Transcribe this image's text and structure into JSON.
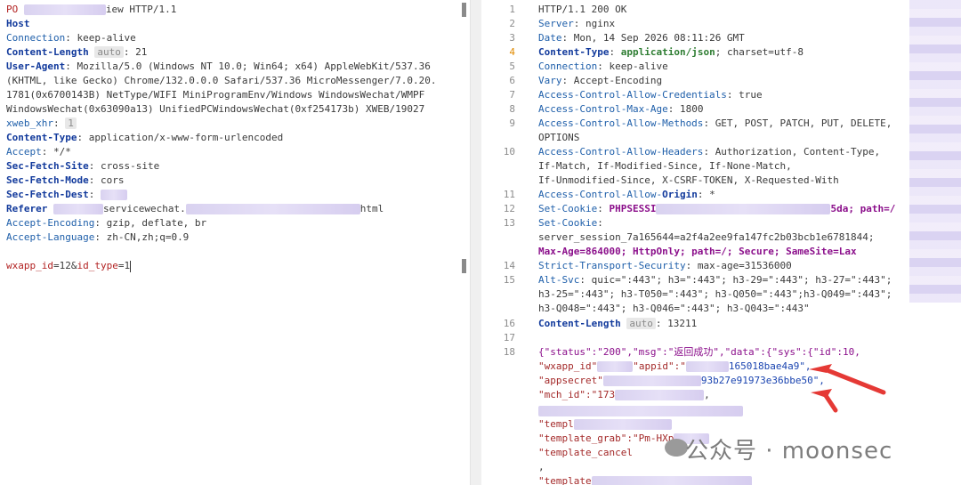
{
  "request": {
    "line1_prefix": "PO",
    "line1_suffix": "iew HTTP/1.1",
    "host_key": "Host",
    "connection_key": "Connection",
    "connection_val": "keep-alive",
    "content_length_key": "Content-Length",
    "auto_badge": "auto",
    "content_length_val": "21",
    "ua_key": "User-Agent",
    "ua_line1": "Mozilla/5.0 (Windows NT 10.0; Win64; x64) AppleWebKit/537.36",
    "ua_line2": "(KHTML, like Gecko) Chrome/132.0.0.0 Safari/537.36 MicroMessenger/7.0.20.",
    "ua_line3": "1781(0x6700143B) NetType/WIFI MiniProgramEnv/Windows WindowsWechat/WMPF",
    "ua_line4": "WindowsWechat(0x63090a13) UnifiedPCWindowsWechat(0xf254173b) XWEB/19027",
    "xweb_key": "xweb_xhr",
    "xweb_val": "1",
    "ctype_key": "Content-Type",
    "ctype_val": "application/x-www-form-urlencoded",
    "accept_key": "Accept",
    "accept_val": "*/*",
    "sfs_key": "Sec-Fetch-Site",
    "sfs_val": "cross-site",
    "sfm_key": "Sec-Fetch-Mode",
    "sfm_val": "cors",
    "sfd_key": "Sec-Fetch-Dest",
    "referer_key": "Referer",
    "referer_mid": "servicewechat.",
    "referer_end": "html",
    "ae_key": "Accept-Encoding",
    "ae_val": "gzip, deflate, br",
    "al_key": "Accept-Language",
    "al_val": "zh-CN,zh;q=0.9",
    "body_a": "wxapp_id",
    "body_b": "=12&",
    "body_c": "id_type",
    "body_d": "=1"
  },
  "response": {
    "line_numbers": [
      "1",
      "2",
      "3",
      "4",
      "5",
      "6",
      "7",
      "8",
      "9",
      "10",
      "11",
      "12",
      "13",
      "14",
      "15",
      "16",
      "17",
      "18"
    ],
    "status_line": "HTTP/1.1 200 OK",
    "server_key": "Server",
    "server_val": "nginx",
    "date_key": "Date",
    "date_val": "Mon, 14 Sep 2026 08:11:26 GMT",
    "ct_key": "Content-Type",
    "ct_val_a": "application/json",
    "ct_val_b": "; charset=utf-8",
    "conn_key": "Connection",
    "conn_val": "keep-alive",
    "vary_key": "Vary",
    "vary_val": "Accept-Encoding",
    "acac_key": "Access-Control-Allow-Credentials",
    "acac_val": "true",
    "acma_key": "Access-Control-Max-Age",
    "acma_val": "1800",
    "acam_key": "Access-Control-Allow-Methods",
    "acam_val1": "GET, POST, PATCH, PUT, DELETE,",
    "acam_val2": "OPTIONS",
    "acah_key": "Access-Control-Allow-Headers",
    "acah_val1": "Authorization, Content-Type,",
    "acah_val2": "If-Match, If-Modified-Since, If-None-Match,",
    "acah_val3": "If-Unmodified-Since, X-CSRF-TOKEN, X-Requested-With",
    "acao_key_a": "Access-Control-Allow-",
    "acao_key_b": "Origin",
    "acao_val": "*",
    "sc1_key": "Set-Cookie",
    "sc1_val_a": "PHPSESSI",
    "sc1_val_b": "5da",
    "sc1_val_c": "; path=/",
    "sc2_key": "Set-Cookie",
    "sc2_val": "server_session_7a165644=a2f4a2ee9fa147fc2b03bcb1e6781844;",
    "sc2_val2": "Max-Age=864000; HttpOnly; path=/; Secure; SameSite=Lax",
    "sts_key": "Strict-Transport-Security",
    "sts_val": "max-age=31536000",
    "alt_key": "Alt-Svc",
    "alt_val1": "quic=\":443\"; h3=\":443\"; h3-29=\":443\"; h3-27=\":443\";",
    "alt_val2": "h3-25=\":443\"; h3-T050=\":443\"; h3-Q050=\":443\";h3-Q049=\":443\";",
    "alt_val3": "h3-Q048=\":443\"; h3-Q046=\":443\"; h3-Q043=\":443\"",
    "cl_key": "Content-Length",
    "cl_badge": "auto",
    "cl_val": "13211",
    "json1": "{\"status\":\"200\",\"msg\":\"返回成功\",\"data\":{\"sys\":{\"id\":10,",
    "json2_a": "\"wxapp_id\"",
    "json2_b": "\"appid\":\"",
    "json2_c": "165018bae4a9\",",
    "json3_a": "\"appsecret\"",
    "json3_b": "93b27e91973e36bbe50\",",
    "json4_a": "\"mch_id\":\"173",
    "json4_b": ",",
    "json6": "\"templ",
    "json7_a": "\"template_grab\":\"Pm-HXp",
    "json8": "\"template_cancel",
    "json9": ",",
    "json10": "\"template"
  },
  "watermark": "公众号 · moonsec",
  "colors": {
    "arrow": "#e53935"
  }
}
